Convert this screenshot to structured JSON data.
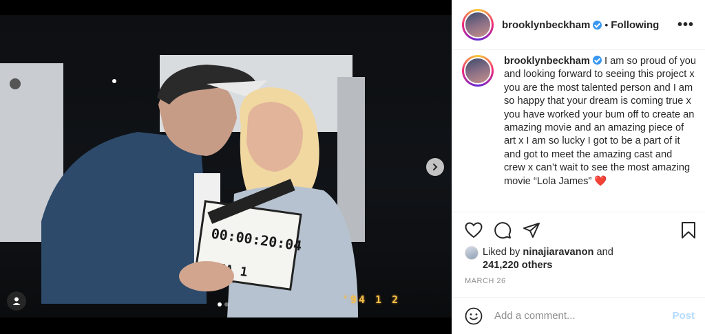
{
  "post": {
    "username": "brooklynbeckham",
    "separator": "•",
    "following_label": "Following",
    "more_label": "•••",
    "caption_text": "I am so proud of you and looking forward to seeing this project x you are the most talented person and I am so happy that your dream is coming true x you have worked your bum off to create an amazing movie and an amazing piece of art x I am so lucky I got to be a part of it and got to meet the amazing cast and crew x can’t wait to see the most amazing movie “Lola James”",
    "caption_emoji": "❤️",
    "liked_by_prefix": "Liked by",
    "liked_by_user": "ninajiaravanon",
    "liked_by_joiner": "and",
    "likes_count": "241,220 others",
    "date": "MARCH 26",
    "comment_placeholder": "Add a comment...",
    "post_button": "Post"
  },
  "photo": {
    "date_stamp": "'94  1  2",
    "clapper_timecode": "00:00:20:04",
    "clapper_label": "117A 1",
    "carousel_index": 1,
    "carousel_total": 2
  },
  "icons": {
    "verified": "verified-badge-icon",
    "like": "heart-icon",
    "comment": "comment-bubble-icon",
    "share": "paper-plane-icon",
    "save": "bookmark-icon",
    "next": "chevron-right-icon",
    "tag": "user-tag-icon",
    "emoji": "smiley-icon"
  },
  "colors": {
    "verified_blue": "#3897f0",
    "post_button_disabled": "#b3dbff",
    "date_stamp": "#f2c14b"
  }
}
